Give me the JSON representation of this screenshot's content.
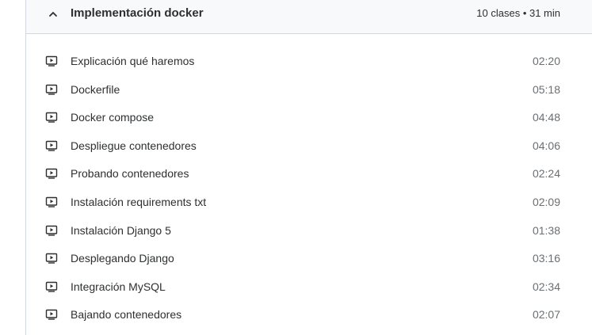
{
  "section": {
    "title": "Implementación docker",
    "meta": "10 clases • 31 min",
    "expanded": true,
    "chevron_icon": "chevron-up-icon"
  },
  "lectures": [
    {
      "title": "Explicación qué haremos",
      "duration": "02:20",
      "icon": "video-icon"
    },
    {
      "title": "Dockerfile",
      "duration": "05:18",
      "icon": "video-icon"
    },
    {
      "title": "Docker compose",
      "duration": "04:48",
      "icon": "video-icon"
    },
    {
      "title": "Despliegue contenedores",
      "duration": "04:06",
      "icon": "video-icon"
    },
    {
      "title": "Probando contenedores",
      "duration": "02:24",
      "icon": "video-icon"
    },
    {
      "title": "Instalación requirements txt",
      "duration": "02:09",
      "icon": "video-icon"
    },
    {
      "title": "Instalación Django 5",
      "duration": "01:38",
      "icon": "video-icon"
    },
    {
      "title": "Desplegando Django",
      "duration": "03:16",
      "icon": "video-icon"
    },
    {
      "title": "Integración MySQL",
      "duration": "02:34",
      "icon": "video-icon"
    },
    {
      "title": "Bajando contenedores",
      "duration": "02:07",
      "icon": "video-icon"
    }
  ],
  "colors": {
    "text": "#2d2f31",
    "muted": "#6a6f73",
    "header_bg": "#f7f9fa",
    "border": "#d1d7dc"
  }
}
